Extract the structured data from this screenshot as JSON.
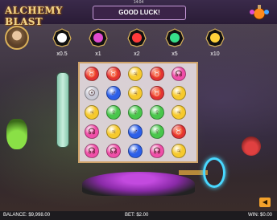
{
  "header": {
    "logo_text": "ALCHEMY BLAST",
    "time": "14:04",
    "message": "GOOD LUCK!"
  },
  "multipliers": [
    {
      "label": "x0.5",
      "gem_color": "#ffffff"
    },
    {
      "label": "x1",
      "gem_color": "#e04ad0"
    },
    {
      "label": "x2",
      "gem_color": "#ff3b3b"
    },
    {
      "label": "x5",
      "gem_color": "#37e08a"
    },
    {
      "label": "x10",
      "gem_color": "#ffd23a"
    }
  ],
  "board": {
    "rows": [
      [
        "red",
        "red",
        "yellow",
        "red",
        "pink"
      ],
      [
        "silver",
        "blue",
        "yellow",
        "red",
        "yellow"
      ],
      [
        "yellow",
        "green",
        "green",
        "green",
        "yellow"
      ],
      [
        "pink",
        "yellow",
        "blue",
        "green",
        "red"
      ],
      [
        "pink",
        "pink",
        "blue",
        "pink",
        "yellow"
      ]
    ],
    "palette": {
      "red": "#e33434",
      "yellow": "#f6c92d",
      "pink": "#f04fa8",
      "blue": "#2d5fe8",
      "green": "#49c64b",
      "silver": "#c9c9d4"
    },
    "symbols": {
      "red": "♉",
      "yellow": "♃",
      "pink": "☊",
      "blue": "♂",
      "green": "♀",
      "silver": "☉"
    }
  },
  "status": {
    "balance": "BALANCE: $9,998.00",
    "bet": "BET: $2.00",
    "win": "WIN: $0.00"
  },
  "icons": {
    "menu": "potion-menu-icon",
    "sound": "speaker-icon",
    "sound_glyph": "◀"
  }
}
